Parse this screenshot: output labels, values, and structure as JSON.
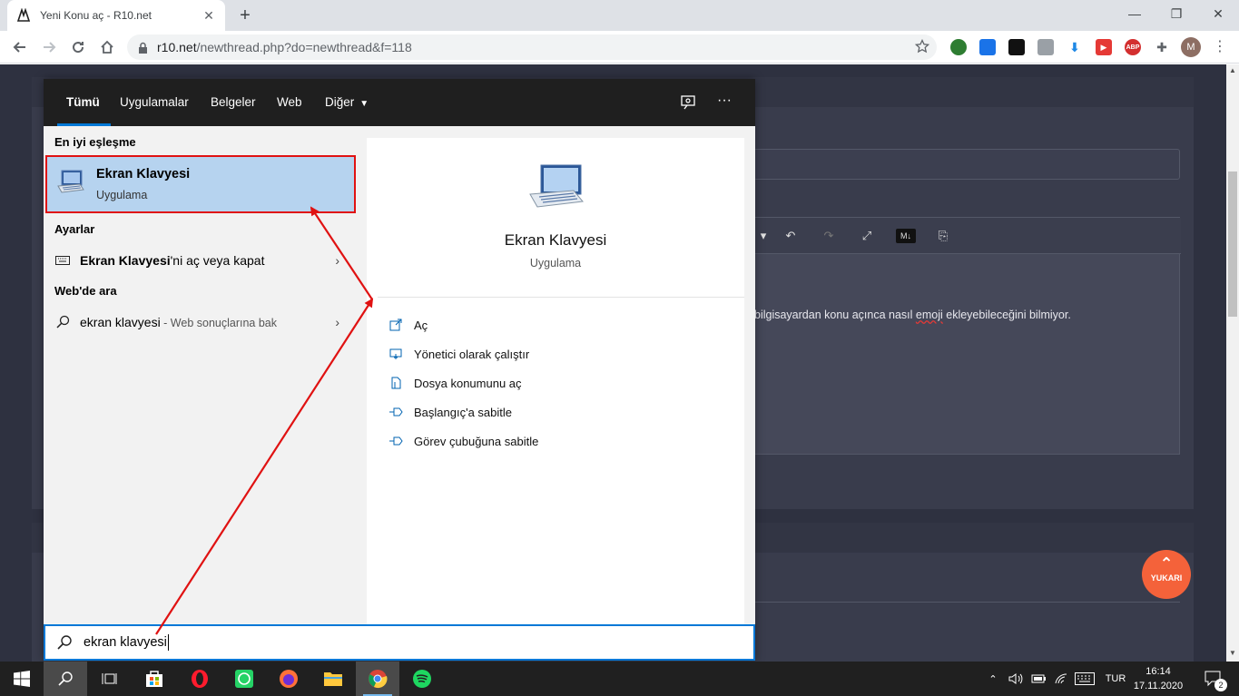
{
  "browser": {
    "tab_title": "Yeni Konu aç - R10.net",
    "new_tab": "+",
    "url_domain": "r10.net",
    "url_path": "/newthread.php?do=newthread&f=118",
    "profile_initial": "M"
  },
  "page": {
    "editor_text_before": "bilgisayardan konu açınca nasıl ",
    "editor_text_misspelled": "emoji",
    "editor_text_after": " ekleyebileceğini bilmiyor.",
    "scroll_top_label": "YUKARI"
  },
  "search": {
    "tabs": [
      {
        "label": "Tümü"
      },
      {
        "label": "Uygulamalar"
      },
      {
        "label": "Belgeler"
      },
      {
        "label": "Web"
      },
      {
        "label": "Diğer"
      }
    ],
    "best_match_header": "En iyi eşleşme",
    "best_match": {
      "title": "Ekran Klavyesi",
      "subtitle": "Uygulama"
    },
    "settings_header": "Ayarlar",
    "settings_item": {
      "bold": "Ekran Klavyesi",
      "rest": "'ni aç veya kapat"
    },
    "web_header": "Web'de ara",
    "web_item": {
      "query": "ekran klavyesi",
      "suffix": " - Web sonuçlarına bak"
    },
    "detail": {
      "title": "Ekran Klavyesi",
      "subtitle": "Uygulama",
      "actions": [
        {
          "label": "Aç",
          "icon": "open-icon"
        },
        {
          "label": "Yönetici olarak çalıştır",
          "icon": "shield-run-icon"
        },
        {
          "label": "Dosya konumunu aç",
          "icon": "file-location-icon"
        },
        {
          "label": "Başlangıç'a sabitle",
          "icon": "pin-icon"
        },
        {
          "label": "Görev çubuğuna sabitle",
          "icon": "pin-icon"
        }
      ]
    },
    "query": "ekran klavyesi"
  },
  "taskbar": {
    "language": "TUR",
    "time": "16:14",
    "date": "17.11.2020",
    "notification_count": "2"
  },
  "colors": {
    "accent": "#0078d7",
    "highlight": "#b6d3ef",
    "annotation_red": "#e01212",
    "page_bg": "#2e3140"
  }
}
